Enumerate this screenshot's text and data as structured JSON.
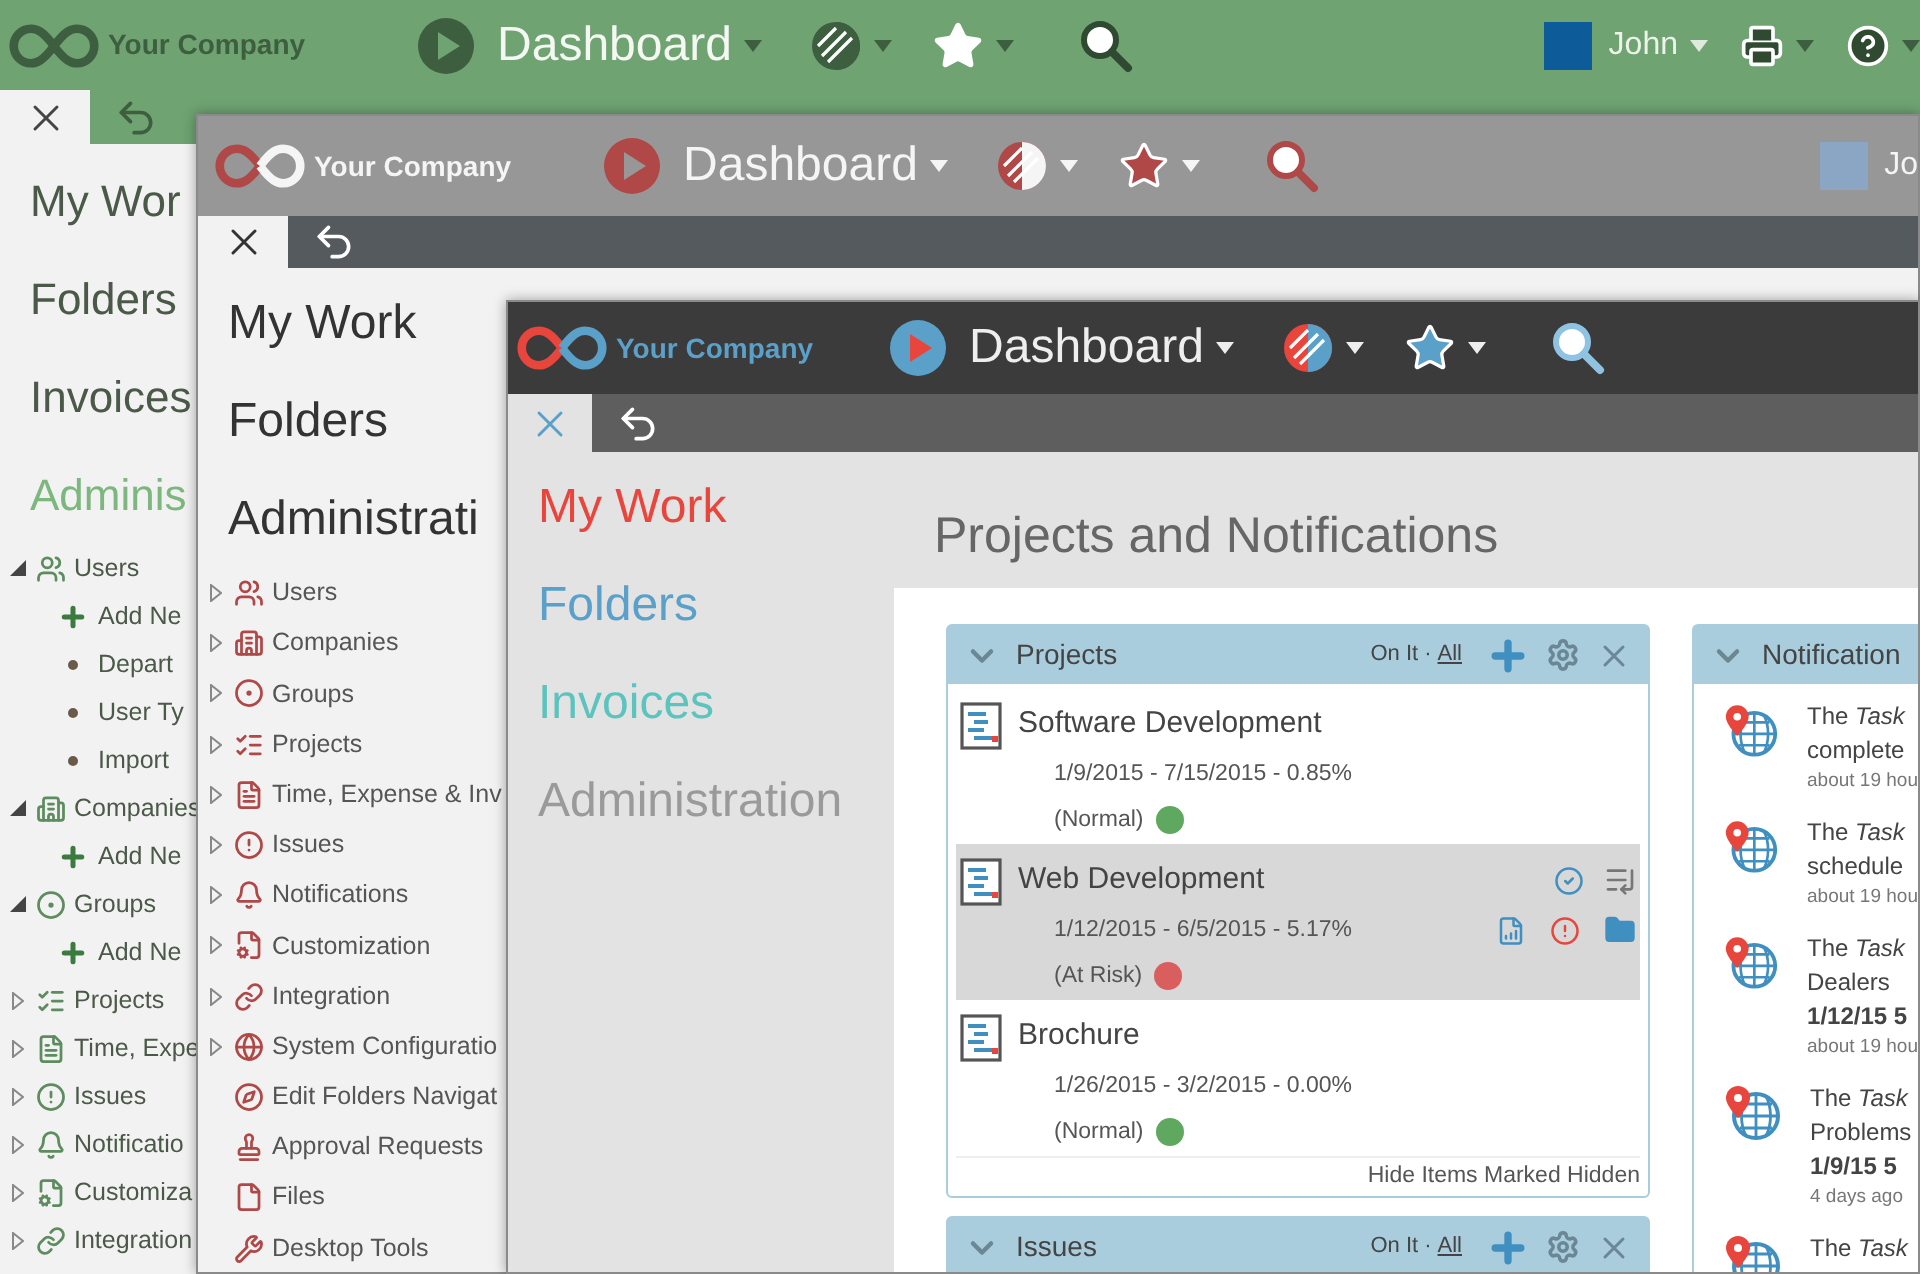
{
  "windows": [
    {
      "kind": "green",
      "brand": "Your Company",
      "title": "Dashboard",
      "user": "John",
      "nav": [
        {
          "label": "My Wor",
          "color": "#4b5a48"
        },
        {
          "label": "Folders",
          "color": "#4b5a48"
        },
        {
          "label": "Invoices",
          "color": "#4b5a48"
        },
        {
          "label": "Adminis",
          "color": "#7cb77e"
        }
      ],
      "tree": [
        {
          "kind": "branch",
          "label": "Users",
          "expanded": true,
          "children": [
            {
              "kind": "add",
              "label": "Add Ne"
            },
            {
              "kind": "bullet",
              "label": "Depart"
            },
            {
              "kind": "bullet",
              "label": "User Ty"
            },
            {
              "kind": "bullet",
              "label": "Import"
            }
          ]
        },
        {
          "kind": "branch",
          "label": "Companies",
          "expanded": true,
          "children": [
            {
              "kind": "add",
              "label": "Add Ne"
            }
          ]
        },
        {
          "kind": "branch",
          "label": "Groups",
          "expanded": true,
          "children": [
            {
              "kind": "add",
              "label": "Add Ne"
            }
          ]
        },
        {
          "kind": "branch",
          "label": "Projects",
          "expanded": false
        },
        {
          "kind": "branch",
          "label": "Time, Expe",
          "expanded": false
        },
        {
          "kind": "branch",
          "label": "Issues",
          "expanded": false
        },
        {
          "kind": "branch",
          "label": "Notificatio",
          "expanded": false
        },
        {
          "kind": "branch",
          "label": "Customiza",
          "expanded": false
        },
        {
          "kind": "branch",
          "label": "Integration",
          "expanded": false
        }
      ]
    },
    {
      "kind": "gray",
      "brand": "Your Company",
      "title": "Dashboard",
      "user": "Jo",
      "nav": [
        {
          "label": "My Work",
          "color": "#333333"
        },
        {
          "label": "Folders",
          "color": "#333333"
        },
        {
          "label": "Administrati",
          "color": "#333333"
        }
      ],
      "tree": [
        {
          "kind": "branch",
          "label": "Users",
          "expanded": false
        },
        {
          "kind": "branch",
          "label": "Companies",
          "expanded": false
        },
        {
          "kind": "branch",
          "label": "Groups",
          "expanded": false
        },
        {
          "kind": "branch",
          "label": "Projects",
          "expanded": false
        },
        {
          "kind": "branch",
          "label": "Time, Expense & Inv",
          "expanded": false
        },
        {
          "kind": "branch",
          "label": "Issues",
          "expanded": false
        },
        {
          "kind": "branch",
          "label": "Notifications",
          "expanded": false
        },
        {
          "kind": "branch",
          "label": "Customization",
          "expanded": false
        },
        {
          "kind": "branch",
          "label": "Integration",
          "expanded": false
        },
        {
          "kind": "branch",
          "label": "System Configuratio",
          "expanded": false
        },
        {
          "kind": "leaf",
          "label": "Edit Folders Navigat"
        },
        {
          "kind": "leaf",
          "label": "Approval Requests"
        },
        {
          "kind": "leaf",
          "label": "Files"
        },
        {
          "kind": "leaf",
          "label": "Desktop Tools"
        }
      ]
    },
    {
      "kind": "dark",
      "brand": "Your Company",
      "title": "Dashboard",
      "nav": [
        {
          "label": "My Work",
          "color": "#e8453c"
        },
        {
          "label": "Folders",
          "color": "#5aa0c8"
        },
        {
          "label": "Invoices",
          "color": "#5bc4bf"
        },
        {
          "label": "Administration",
          "color": "#9a9a9a"
        }
      ],
      "content": {
        "title": "Projects and Notifications",
        "projects": {
          "title": "Projects",
          "filter": "On It",
          "separator": "·",
          "filter_link": "All",
          "rows": [
            {
              "name": "Software Development",
              "dates": "1/9/2015 - 7/15/2015 - 0.85%",
              "status": "(Normal)",
              "color": "#5fa85f",
              "selected": false
            },
            {
              "name": "Web Development",
              "dates": "1/12/2015 - 6/5/2015 - 5.17%",
              "status": "(At Risk)",
              "color": "#d95f5f",
              "selected": true
            },
            {
              "name": "Brochure",
              "dates": "1/26/2015 - 3/2/2015 - 0.00%",
              "status": "(Normal)",
              "color": "#5fa85f",
              "selected": false
            }
          ],
          "footer": "Hide Items Marked Hidden"
        },
        "notifications": {
          "title": "Notification",
          "items": [
            {
              "lines": [
                "The *Task*",
                "complete"
              ],
              "time": "about 19 hou"
            },
            {
              "lines": [
                "The *Task*",
                "schedule"
              ],
              "time": "about 19 hou"
            },
            {
              "lines": [
                "The *Task*",
                "Dealers"
              ],
              "date": "1/12/15 5",
              "time": "about 19 hou"
            },
            {
              "lines": [
                "The *Task*",
                "Problems"
              ],
              "date": "1/9/15 5",
              "time": "4 days ago"
            },
            {
              "lines": [
                "The *Task*"
              ]
            }
          ]
        },
        "issues": {
          "title": "Issues",
          "filter": "On It",
          "separator": "·",
          "filter_link": "All"
        }
      }
    }
  ]
}
